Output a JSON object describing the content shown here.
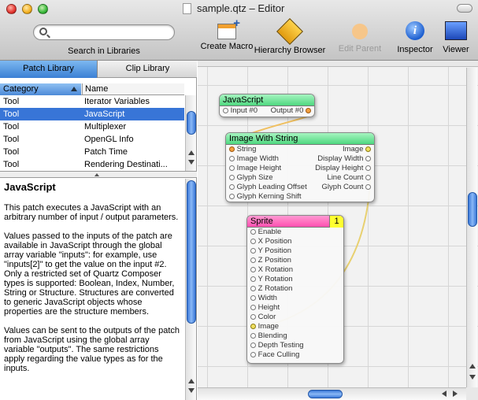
{
  "window": {
    "title": "sample.qtz – Editor"
  },
  "toolbar": {
    "search_placeholder": "",
    "search_label": "Search in Libraries",
    "buttons": [
      {
        "label": "Create Macro",
        "icon": "create-macro-icon",
        "enabled": true
      },
      {
        "label": "Hierarchy Browser",
        "icon": "hierarchy-browser-icon",
        "enabled": true
      },
      {
        "label": "Edit Parent",
        "icon": "edit-parent-icon",
        "enabled": false
      },
      {
        "label": "Inspector",
        "icon": "info-icon",
        "enabled": true
      },
      {
        "label": "Viewer",
        "icon": "viewer-icon",
        "enabled": true
      }
    ]
  },
  "library": {
    "tabs": [
      {
        "label": "Patch Library",
        "selected": true
      },
      {
        "label": "Clip Library",
        "selected": false
      }
    ],
    "columns": {
      "category": "Category",
      "name": "Name"
    },
    "rows": [
      {
        "category": "Tool",
        "name": "Iterator Variables"
      },
      {
        "category": "Tool",
        "name": "JavaScript",
        "selected": true
      },
      {
        "category": "Tool",
        "name": "Multiplexer"
      },
      {
        "category": "Tool",
        "name": "OpenGL Info"
      },
      {
        "category": "Tool",
        "name": "Patch Time"
      },
      {
        "category": "Tool",
        "name": "Rendering Destinati..."
      }
    ]
  },
  "description": {
    "title": "JavaScript",
    "paragraphs": [
      "This patch executes a JavaScript with an arbitrary number of input / output parameters.",
      "Values passed to the inputs of the patch are available in JavaScript through the global array variable \"inputs\": for example, use \"inputs[2]\" to get the value on the input #2. Only a restricted set of Quartz Composer types is supported: Boolean, Index, Number, String or Structure. Structures are converted to generic JavaScript objects whose properties are the structure members.",
      "Values can be sent to the outputs of the patch from JavaScript using the global array variable \"outputs\". The same restrictions apply regarding the value types as for the inputs."
    ]
  },
  "patches": {
    "javascript": {
      "title": "JavaScript",
      "input": "Input #0",
      "output": "Output #0"
    },
    "image_with_string": {
      "title": "Image With String",
      "inputs": [
        "String",
        "Image Width",
        "Image Height",
        "Glyph Size",
        "Glyph Leading Offset",
        "Glyph Kerning Shift"
      ],
      "outputs": [
        "Image",
        "Display Width",
        "Display Height",
        "Line Count",
        "Glyph Count"
      ]
    },
    "sprite": {
      "title": "Sprite",
      "layer": "1",
      "inputs": [
        "Enable",
        "X Position",
        "Y Position",
        "Z Position",
        "X Rotation",
        "Y Rotation",
        "Z Rotation",
        "Width",
        "Height",
        "Color",
        "Image",
        "Blending",
        "Depth Testing",
        "Face Culling"
      ]
    }
  },
  "colors": {
    "selection": "#3875d7",
    "js_header": "#4fd880",
    "sprite_header": "#ff4fb0",
    "layer_badge": "#ffff30"
  }
}
